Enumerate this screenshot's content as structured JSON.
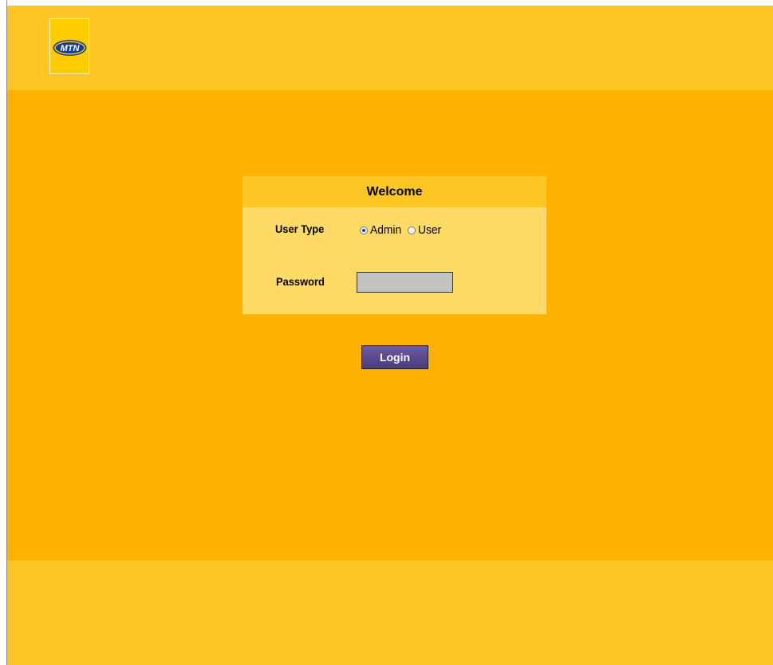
{
  "brand": {
    "logo_text": "MTN",
    "accent_yellow": "#ffb300",
    "header_yellow": "#ffc726",
    "panel_body_yellow": "#ffda66",
    "button_purple": "#5a4a8e"
  },
  "login_panel": {
    "title": "Welcome",
    "user_type": {
      "label": "User Type",
      "options": [
        {
          "label": "Admin",
          "selected": true
        },
        {
          "label": "User",
          "selected": false
        }
      ]
    },
    "password": {
      "label": "Password",
      "value": ""
    }
  },
  "login_button": {
    "label": "Login"
  }
}
